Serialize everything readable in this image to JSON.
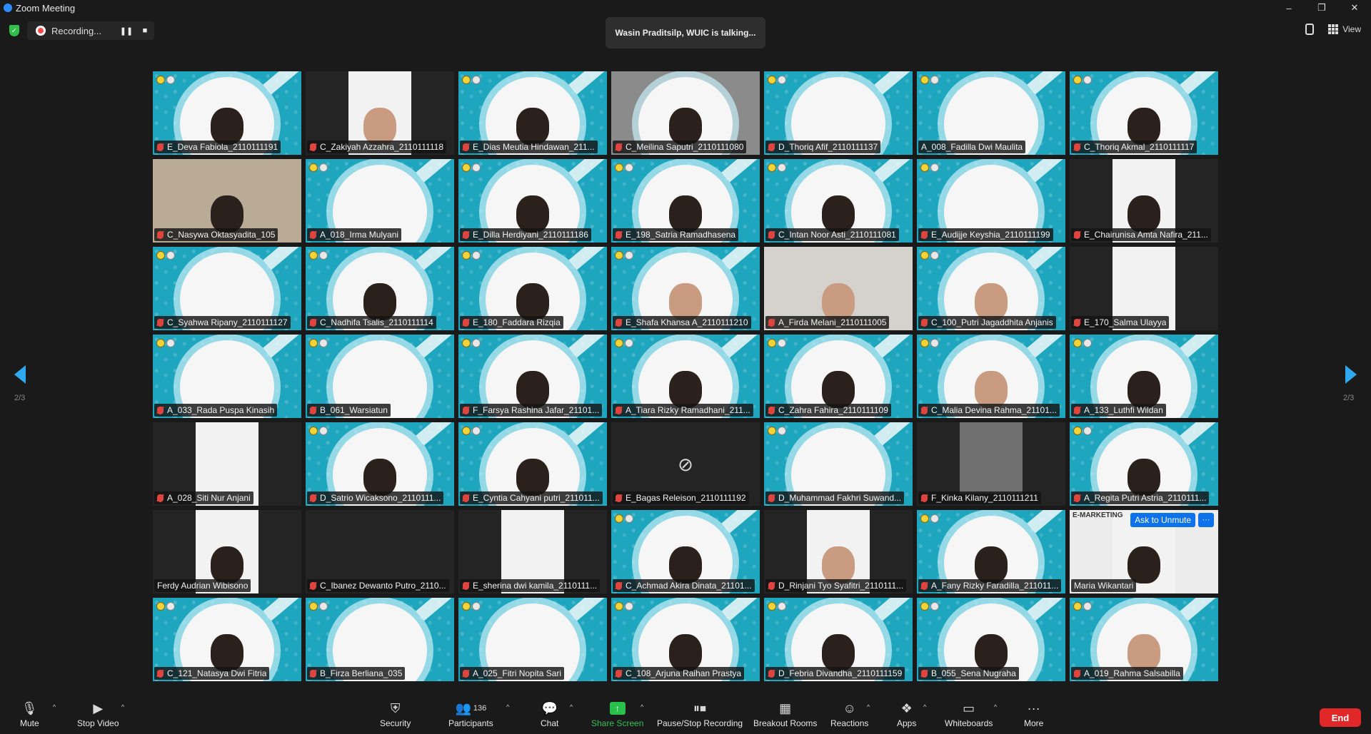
{
  "window": {
    "title": "Zoom Meeting",
    "minimize": "–",
    "restore": "❐",
    "close": "✕"
  },
  "recording": {
    "label": "Recording...",
    "pause": "❚❚",
    "stop": "■"
  },
  "talking": {
    "text": "Wasin Praditsilp, WUIC is talking..."
  },
  "top_right": {
    "view_label": "View"
  },
  "pagination": {
    "left": "2/3",
    "right": "2/3"
  },
  "colors": {
    "accent": "#2d8cff",
    "share": "#2ac04c",
    "end": "#e02828",
    "tile_cyan": "#1fa6bf"
  },
  "tiles": [
    {
      "name": "E_Deva Fabiola_2110111191",
      "style": "bg-cyan",
      "content": "circle",
      "face": "dark",
      "muted": true
    },
    {
      "name": "C_Zakiyah Azzahra_2110111118",
      "style": "bg-dark",
      "content": "whitebox",
      "face": "light",
      "muted": true
    },
    {
      "name": "E_Dias Meutia Hindawan_211...",
      "style": "bg-cyan",
      "content": "circle",
      "face": "dark",
      "muted": true
    },
    {
      "name": "C_Meilina Saputri_2110111080",
      "style": "bg-gray",
      "content": "circle",
      "face": "dark",
      "muted": true
    },
    {
      "name": "D_Thoriq Afif_2110111137",
      "style": "bg-cyan",
      "content": "circle",
      "face": "",
      "muted": true
    },
    {
      "name": "A_008_Fadilla Dwi Maulita",
      "style": "bg-cyan",
      "content": "circle",
      "face": "",
      "muted": false
    },
    {
      "name": "C_Thoriq Akmal_2110111117",
      "style": "bg-cyan",
      "content": "circle",
      "face": "dark",
      "muted": true
    },
    {
      "name": "C_Nasywa Oktasyadita_105",
      "style": "bg-room",
      "content": "",
      "face": "dark",
      "muted": true
    },
    {
      "name": "A_018_Irma Mulyani",
      "style": "bg-cyan",
      "content": "circle",
      "face": "",
      "muted": true
    },
    {
      "name": "E_Dilla Herdiyani_2110111186",
      "style": "bg-cyan",
      "content": "circle",
      "face": "dark",
      "muted": true
    },
    {
      "name": "E_198_Satria Ramadhasena",
      "style": "bg-cyan",
      "content": "circle",
      "face": "dark",
      "muted": true
    },
    {
      "name": "C_Intan Noor Asti_2110111081",
      "style": "bg-cyan",
      "content": "circle",
      "face": "dark",
      "muted": true
    },
    {
      "name": "E_Audijje Keyshia_2110111199",
      "style": "bg-cyan",
      "content": "circle",
      "face": "",
      "muted": true
    },
    {
      "name": "E_Chairunisa Amta Nafira_211...",
      "style": "bg-dark",
      "content": "whitebox",
      "face": "dark",
      "muted": true
    },
    {
      "name": "C_Syahwa Ripany_2110111127",
      "style": "bg-cyan",
      "content": "circle",
      "face": "",
      "muted": true
    },
    {
      "name": "C_Nadhifa Tsalis_2110111114",
      "style": "bg-cyan",
      "content": "circle",
      "face": "dark",
      "muted": true
    },
    {
      "name": "E_180_Faddara Rizqia",
      "style": "bg-cyan",
      "content": "circle",
      "face": "dark",
      "muted": true
    },
    {
      "name": "E_Shafa Khansa A_2110111210",
      "style": "bg-cyan",
      "content": "circle",
      "face": "light",
      "muted": true
    },
    {
      "name": "A_Firda Melani_2110111005",
      "style": "bg-wall",
      "content": "",
      "face": "light",
      "muted": true
    },
    {
      "name": "C_100_Putri Jagaddhita Anjanis",
      "style": "bg-cyan",
      "content": "circle",
      "face": "light",
      "muted": true
    },
    {
      "name": "E_170_Salma Ulayya",
      "style": "bg-dark",
      "content": "whitebox",
      "face": "",
      "muted": true
    },
    {
      "name": "A_033_Rada Puspa Kinasih",
      "style": "bg-cyan",
      "content": "circle",
      "face": "",
      "muted": true
    },
    {
      "name": "B_061_Warsiatun",
      "style": "bg-cyan",
      "content": "circle",
      "face": "",
      "muted": true
    },
    {
      "name": "F_Farsya Rashina Jafar_21101...",
      "style": "bg-cyan",
      "content": "circle",
      "face": "dark",
      "muted": true
    },
    {
      "name": "A_Tiara Rizky Ramadhani_211...",
      "style": "bg-cyan",
      "content": "circle",
      "face": "dark",
      "muted": true
    },
    {
      "name": "C_Zahra Fahira_2110111109",
      "style": "bg-cyan",
      "content": "circle",
      "face": "dark",
      "muted": true
    },
    {
      "name": "C_Malia Devina Rahma_21101...",
      "style": "bg-cyan",
      "content": "circle",
      "face": "light",
      "muted": true
    },
    {
      "name": "A_133_Luthfi Wildan",
      "style": "bg-cyan",
      "content": "circle",
      "face": "dark",
      "muted": true
    },
    {
      "name": "A_028_Siti Nur Anjani",
      "style": "bg-dark",
      "content": "whitebox",
      "face": "",
      "muted": true
    },
    {
      "name": "D_Satrio Wicaksono_2110111...",
      "style": "bg-cyan",
      "content": "circle",
      "face": "dark",
      "muted": true
    },
    {
      "name": "E_Cyntia Cahyani putri_211011...",
      "style": "bg-cyan",
      "content": "circle",
      "face": "dark",
      "muted": true
    },
    {
      "name": "E_Bagas Releison_2110111192",
      "style": "bg-dark",
      "content": "camoff",
      "face": "",
      "muted": true
    },
    {
      "name": "D_Muhammad Fakhri Suwand...",
      "style": "bg-cyan",
      "content": "circle",
      "face": "",
      "muted": true
    },
    {
      "name": "F_Kinka Kilany_2110111211",
      "style": "bg-dark",
      "content": "videobox",
      "face": "",
      "muted": true
    },
    {
      "name": "A_Regita Putri Astria_2110111...",
      "style": "bg-cyan",
      "content": "circle",
      "face": "dark",
      "muted": true
    },
    {
      "name": "Ferdy Audrian Wibisono",
      "style": "bg-dark",
      "content": "whitebox",
      "face": "dark",
      "muted": false
    },
    {
      "name": "C_Ibanez Dewanto Putro_2110...",
      "style": "bg-dark",
      "content": "",
      "face": "",
      "muted": true
    },
    {
      "name": "E_sherina dwi kamila_2110111...",
      "style": "bg-dark",
      "content": "whitebox",
      "face": "",
      "muted": true
    },
    {
      "name": "C_Achmad Akira Dinata_21101...",
      "style": "bg-cyan",
      "content": "circle",
      "face": "dark",
      "muted": true
    },
    {
      "name": "D_Rinjani Tyo Syafitri_2110111...",
      "style": "bg-dark",
      "content": "whitebox",
      "face": "light",
      "muted": true
    },
    {
      "name": "A_Fany Rizky Faradilla_211011...",
      "style": "bg-cyan",
      "content": "circle",
      "face": "dark",
      "muted": true
    },
    {
      "name": "Maria Wikantari",
      "style": "bg-mkt",
      "content": "presenter",
      "face": "dark",
      "muted": false,
      "label": "E-MARKETING",
      "unmute": "Ask to Unmute",
      "more": "···"
    },
    {
      "name": "C_121_Natasya Dwi Fitria",
      "style": "bg-cyan",
      "content": "circle",
      "face": "dark",
      "muted": true
    },
    {
      "name": "B_Firza Berliana_035",
      "style": "bg-cyan",
      "content": "circle",
      "face": "",
      "muted": true
    },
    {
      "name": "A_025_Fitri Nopita Sari",
      "style": "bg-cyan",
      "content": "circle",
      "face": "",
      "muted": true
    },
    {
      "name": "C_108_Arjuna Raihan Prastya",
      "style": "bg-cyan",
      "content": "circle",
      "face": "dark",
      "muted": true
    },
    {
      "name": "D_Febria Divandha_2110111159",
      "style": "bg-cyan",
      "content": "circle",
      "face": "dark",
      "muted": true
    },
    {
      "name": "B_055_Sena Nugraha",
      "style": "bg-cyan",
      "content": "circle",
      "face": "dark",
      "muted": true
    },
    {
      "name": "A_019_Rahma Salsabilla",
      "style": "bg-cyan",
      "content": "circle",
      "face": "light",
      "muted": true
    }
  ],
  "toolbar": {
    "mute": "Mute",
    "stop_video": "Stop Video",
    "security": "Security",
    "participants": "Participants",
    "participant_count": "136",
    "chat": "Chat",
    "share_screen": "Share Screen",
    "pause_recording": "Pause/Stop Recording",
    "breakout": "Breakout Rooms",
    "reactions": "Reactions",
    "apps": "Apps",
    "whiteboards": "Whiteboards",
    "more": "More",
    "end": "End"
  }
}
